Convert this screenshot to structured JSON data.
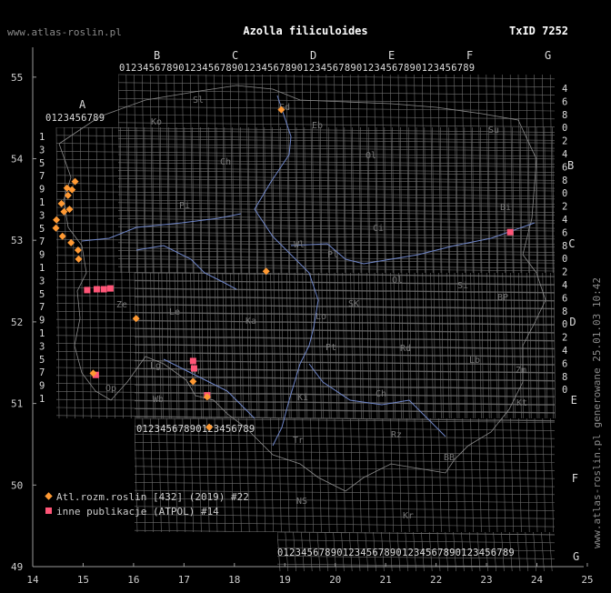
{
  "header": {
    "site": "www.atlas-roslin.pl",
    "title": "Azolla filiculoides",
    "taxon": "TxID 7252",
    "side_note": "www.atlas-roslin.pl generowane 25.01.03 10:42"
  },
  "axes": {
    "x_ticks": [
      "14",
      "15",
      "16",
      "17",
      "18",
      "19",
      "20",
      "21",
      "22",
      "23",
      "24",
      "25"
    ],
    "y_ticks": [
      "55",
      "54",
      "53",
      "52",
      "51",
      "50",
      "49"
    ]
  },
  "grid": {
    "top_letters": [
      "B",
      "C",
      "D",
      "E",
      "F",
      "G"
    ],
    "left_letter": "A",
    "right_letters": [
      "B",
      "C",
      "D",
      "E",
      "F",
      "G"
    ],
    "digits": "0123456789"
  },
  "regions": [
    "Sl",
    "Ko",
    "Gd",
    "Eb",
    "Ol",
    "Su",
    "Ch",
    "Pi",
    "Bi",
    "Ci",
    "Wl",
    "Pl",
    "Ol",
    "Si",
    "Ze",
    "Le",
    "Ka",
    "Lo",
    "SK",
    "BP",
    "Pt",
    "Rd",
    "Lb",
    "Lg",
    "Wr",
    "Op",
    "Wb",
    "Ki",
    "Ch",
    "Zm",
    "Kt",
    "Tr",
    "Rz",
    "BB",
    "NS",
    "Kr"
  ],
  "legend": [
    {
      "label": "Atl.rozm.roslin [432] (2019) #22",
      "color": "#ff9933",
      "shape": "diamond"
    },
    {
      "label": "inne publikacje (ATPOL) #14",
      "color": "#ff5577",
      "shape": "square"
    }
  ],
  "colors": {
    "grid": "#6e6e6e",
    "river": "#6f86c9",
    "border": "#8a8a8a"
  },
  "records_atlas": [
    [
      54.6,
      18.93
    ],
    [
      53.72,
      14.84
    ],
    [
      53.64,
      14.68
    ],
    [
      53.62,
      14.78
    ],
    [
      53.55,
      14.7
    ],
    [
      53.45,
      14.57
    ],
    [
      53.38,
      14.73
    ],
    [
      53.35,
      14.62
    ],
    [
      53.25,
      14.47
    ],
    [
      53.15,
      14.46
    ],
    [
      53.05,
      14.59
    ],
    [
      52.97,
      14.76
    ],
    [
      52.88,
      14.9
    ],
    [
      52.77,
      14.91
    ],
    [
      52.62,
      18.63
    ],
    [
      52.04,
      16.05
    ],
    [
      51.37,
      15.2
    ],
    [
      51.27,
      17.18
    ],
    [
      51.08,
      17.46
    ],
    [
      50.71,
      17.5
    ]
  ],
  "records_other": [
    [
      52.39,
      15.08
    ],
    [
      52.4,
      15.27
    ],
    [
      52.4,
      15.41
    ],
    [
      52.41,
      15.54
    ],
    [
      51.52,
      17.18
    ],
    [
      51.43,
      17.2
    ],
    [
      51.35,
      15.25
    ],
    [
      51.1,
      17.46
    ],
    [
      53.1,
      23.47
    ]
  ]
}
